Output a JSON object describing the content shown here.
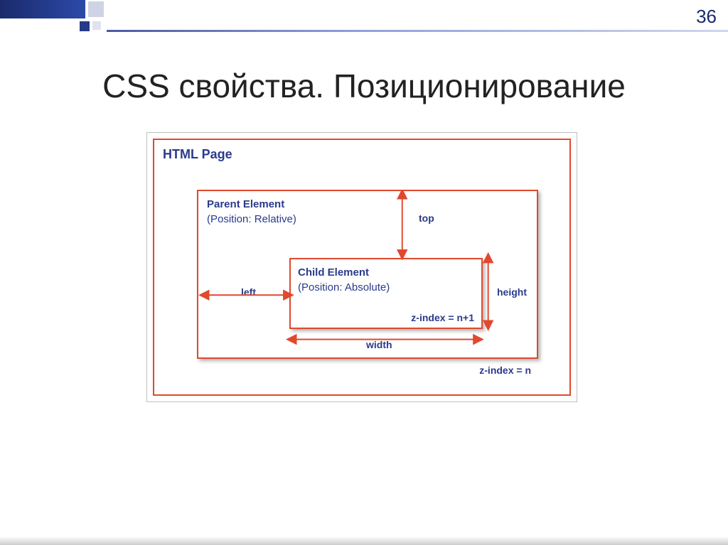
{
  "slide": {
    "number": "36",
    "title": "CSS свойства. Позиционирование"
  },
  "diagram": {
    "page_label": "HTML Page",
    "parent": {
      "title": "Parent Element",
      "subtitle": "(Position: Relative)",
      "zindex": "z-index = n"
    },
    "child": {
      "title": "Child Element",
      "subtitle": "(Position: Absolute)",
      "zindex": "z-index = n+1"
    },
    "dims": {
      "top": "top",
      "left": "left",
      "width": "width",
      "height": "height"
    }
  }
}
